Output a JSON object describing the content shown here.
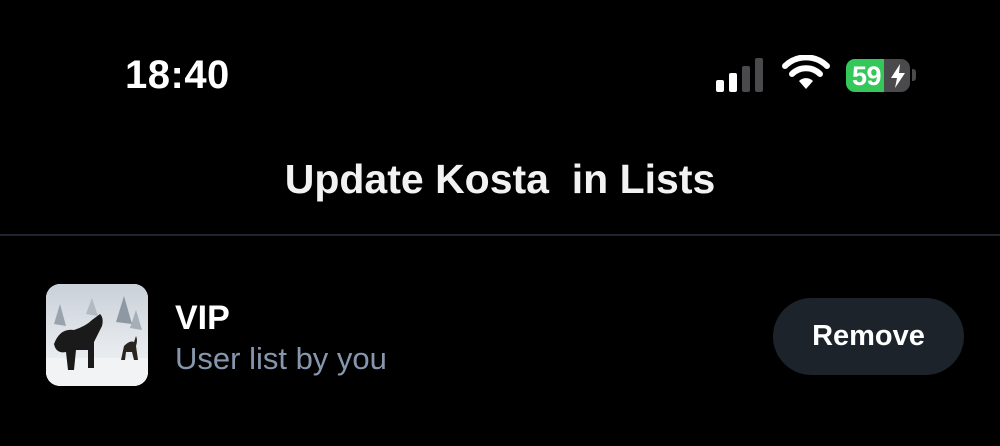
{
  "status_bar": {
    "time": "18:40",
    "battery_level": 59,
    "battery_text": "59",
    "signal_icon": "cellular-signal-icon",
    "wifi_icon": "wifi-icon",
    "charging_icon": "bolt-icon",
    "battery_color": "#34c759"
  },
  "sheet": {
    "title": "Update Kosta  in Lists"
  },
  "lists": [
    {
      "name": "VIP",
      "subtitle": "User list by you",
      "action_label": "Remove"
    }
  ],
  "colors": {
    "background": "#000000",
    "subtitle": "#8696ad",
    "button_bg": "#1d232b",
    "divider": "#1c2530"
  }
}
